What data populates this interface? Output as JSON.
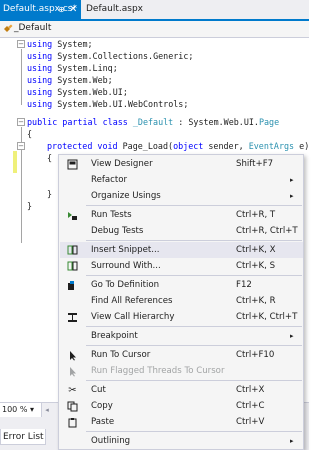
{
  "tabs": {
    "active": {
      "label": "Default.aspx.cs*",
      "pin": "⊕",
      "close": "✕"
    },
    "inactive": {
      "label": "Default.aspx"
    }
  },
  "navbar": {
    "label": "_Default",
    "icon": "class-icon"
  },
  "code": {
    "usings": [
      "System;",
      "System.Collections.Generic;",
      "System.Linq;",
      "System.Web;",
      "System.Web.UI;",
      "System.Web.UI.WebControls;"
    ],
    "using_kw": "using",
    "class_kw": "public partial class",
    "class_name": "_Default",
    "class_colon": " : System.Web.UI.",
    "class_base": "Page",
    "brace_open": "{",
    "brace_close": "}",
    "method_kw": "protected void",
    "method_name": " Page_Load(",
    "method_obj": "object",
    "method_sender": " sender, ",
    "method_args": "EventArgs",
    "method_e": " e)",
    "fold_minus": "−"
  },
  "zoom": {
    "value": "100 %",
    "dropdown": "▾",
    "scroll_left": "◂"
  },
  "bottom": {
    "errorlist": "Error List"
  },
  "menu": {
    "colors": {
      "highlight": "#e6e6ef",
      "background": "#f5f5f5",
      "disabled": "#a2a4a5"
    },
    "items": [
      {
        "label": "View Designer",
        "shortcut": "Shift+F7",
        "icon": "designer-icon"
      },
      {
        "label": "Refactor",
        "arrow": "▸"
      },
      {
        "label": "Organize Usings",
        "arrow": "▸"
      },
      {
        "label": "Run Tests",
        "shortcut": "Ctrl+R, T",
        "icon": "run-tests-icon"
      },
      {
        "label": "Debug Tests",
        "shortcut": "Ctrl+R, Ctrl+T"
      },
      {
        "label": "Insert Snippet...",
        "shortcut": "Ctrl+K, X",
        "icon": "insert-snippet-icon"
      },
      {
        "label": "Surround With...",
        "shortcut": "Ctrl+K, S",
        "icon": "surround-with-icon"
      },
      {
        "label": "Go To Definition",
        "shortcut": "F12",
        "icon": "go-to-definition-icon"
      },
      {
        "label": "Find All References",
        "shortcut": "Ctrl+K, R"
      },
      {
        "label": "View Call Hierarchy",
        "shortcut": "Ctrl+K, Ctrl+T",
        "icon": "call-hierarchy-icon"
      },
      {
        "label": "Breakpoint",
        "arrow": "▸"
      },
      {
        "label": "Run To Cursor",
        "shortcut": "Ctrl+F10",
        "icon": "run-to-cursor-icon"
      },
      {
        "label": "Run Flagged Threads To Cursor",
        "icon": "run-flagged-threads-icon"
      },
      {
        "label": "Cut",
        "shortcut": "Ctrl+X",
        "icon": "cut-icon"
      },
      {
        "label": "Copy",
        "shortcut": "Ctrl+C",
        "icon": "copy-icon"
      },
      {
        "label": "Paste",
        "shortcut": "Ctrl+V",
        "icon": "paste-icon"
      },
      {
        "label": "Outlining",
        "arrow": "▸"
      }
    ]
  }
}
